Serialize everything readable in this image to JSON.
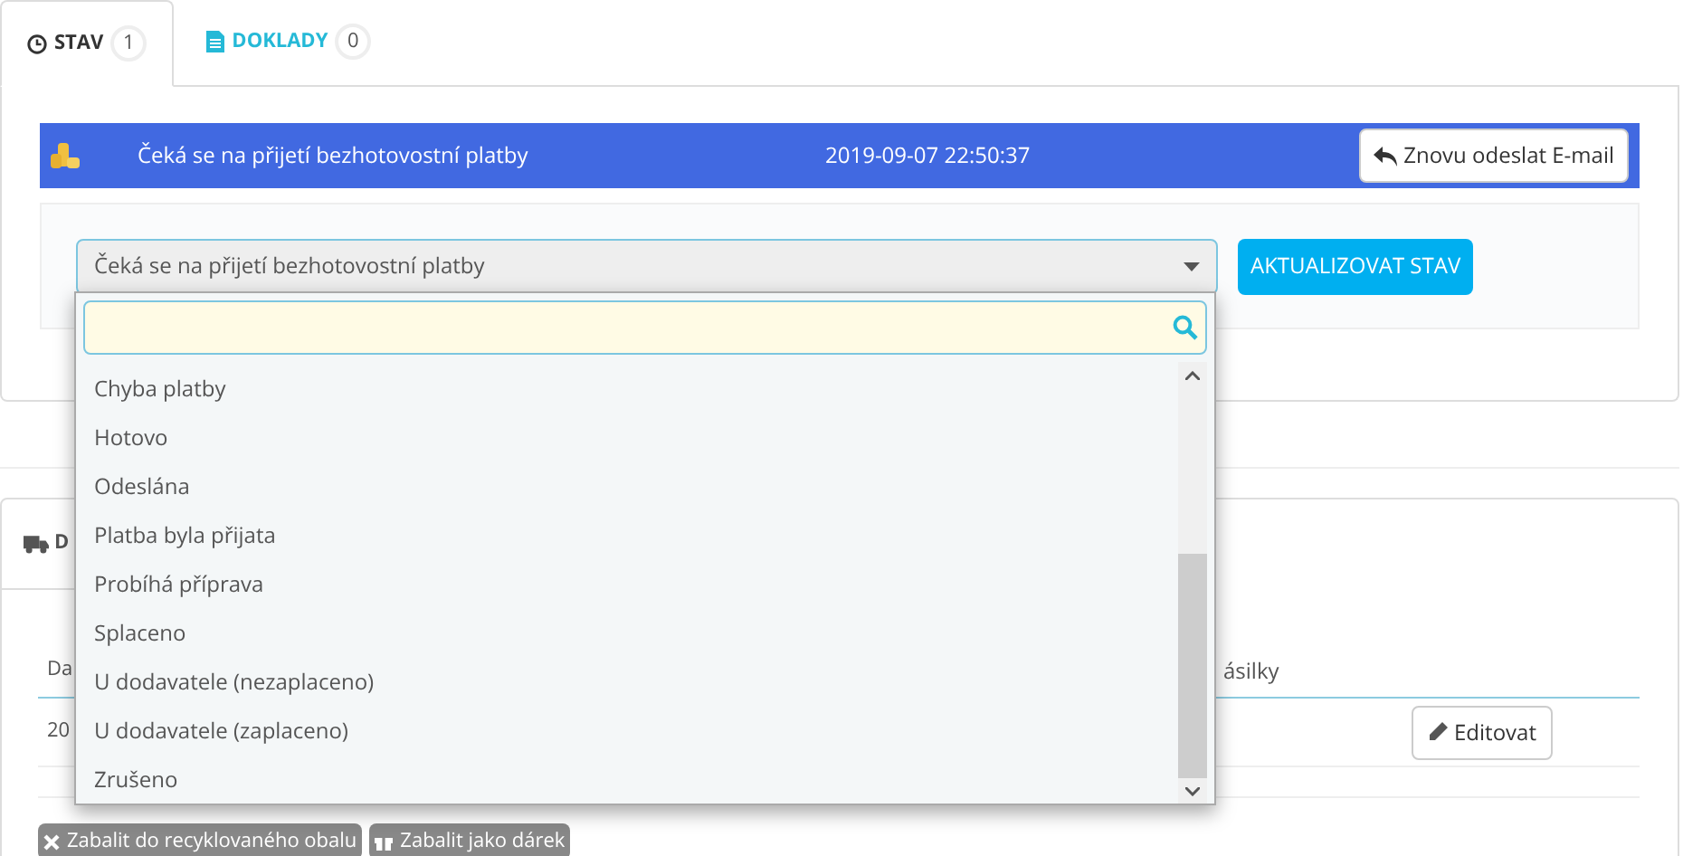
{
  "tabs": [
    {
      "label": "STAV",
      "count": "1",
      "selected": true
    },
    {
      "label": "DOKLADY",
      "count": "0",
      "selected": false
    }
  ],
  "status_bar": {
    "label": "Čeká se na přijetí bezhotovostní platby",
    "date": "2019-09-07 22:50:37",
    "resend_button": "Znovu odeslat E-mail"
  },
  "status_form": {
    "select_value": "Čeká se na přijetí bezhotovostní platby",
    "update_button": "AKTUALIZOVAT STAV"
  },
  "dropdown": {
    "options": [
      "Chyba platby",
      "Hotovo",
      "Odeslána",
      "Platba byla přijata",
      "Probíhá příprava",
      "Splaceno",
      "U dodavatele (nezaplaceno)",
      "U dodavatele (zaplaceno)",
      "Zrušeno"
    ]
  },
  "shipping": {
    "heading": "D",
    "column_1": "Da",
    "column_last": "ásilky",
    "row_cell": "20",
    "edit_button": "Editovat",
    "actions": [
      "Zabalit do recyklovaného obalu",
      "Zabalit jako dárek"
    ]
  }
}
